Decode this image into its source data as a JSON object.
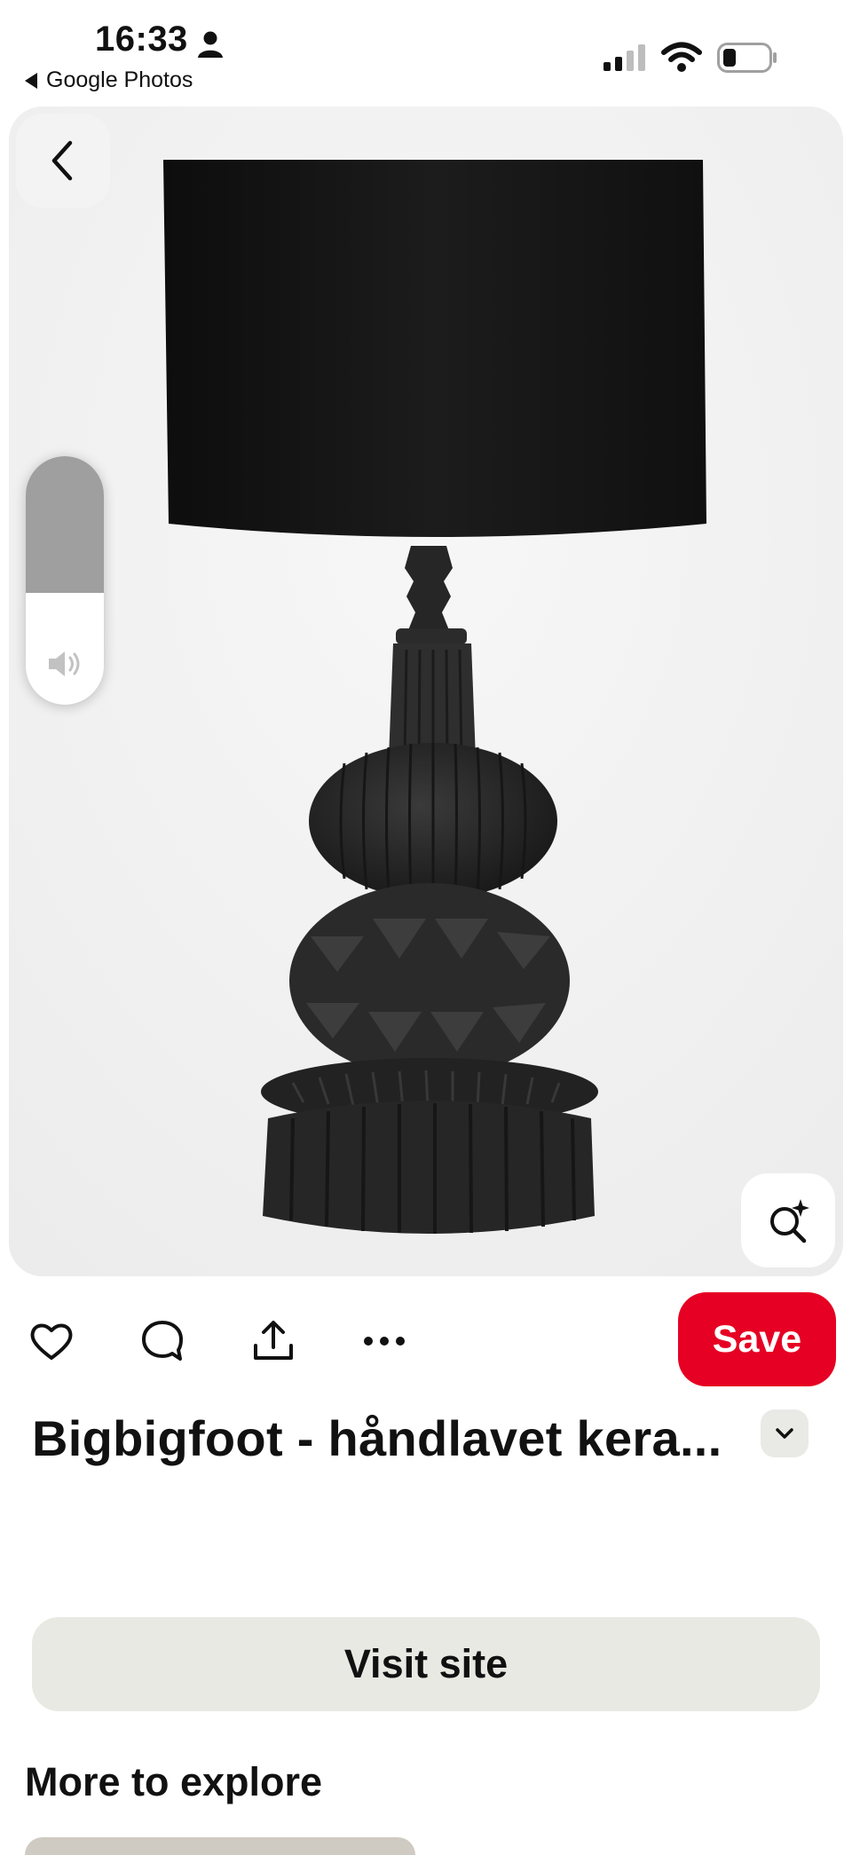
{
  "status_bar": {
    "time": "16:33",
    "back_app_label": "Google Photos",
    "icons": [
      "person-icon",
      "signal-icon",
      "wifi-icon",
      "battery-icon"
    ]
  },
  "image": {
    "subject": "black ceramic table lamp",
    "volume_level_fraction": 0.55
  },
  "actions": {
    "icons": [
      "heart-icon",
      "comment-icon",
      "share-icon",
      "more-icon"
    ],
    "save_label": "Save"
  },
  "pin": {
    "title": "Bigbigfoot - håndlavet kera..."
  },
  "visit_label": "Visit site",
  "more_to_explore": "More to explore",
  "colors": {
    "save_red": "#e60023",
    "visit_bg": "#e9e9e4",
    "card_bg": "#f0f0f0"
  }
}
